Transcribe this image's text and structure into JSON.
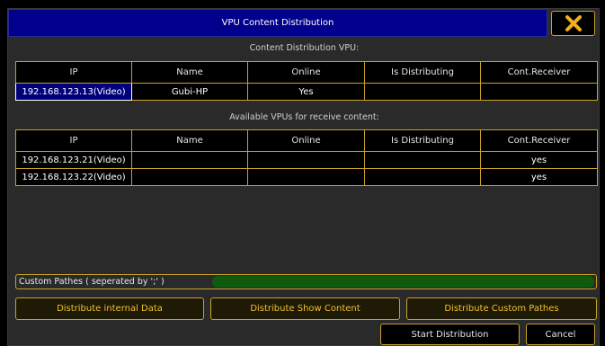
{
  "window": {
    "title": "VPU Content Distribution",
    "close_icon": "close-x-icon"
  },
  "content_distribution": {
    "section_label": "Content Distribution VPU:",
    "columns": [
      "IP",
      "Name",
      "Online",
      "Is Distributing",
      "Cont.Receiver"
    ],
    "rows": [
      {
        "ip": "192.168.123.13(Video)",
        "name": "Gubi-HP",
        "online": "Yes",
        "is_distributing": "",
        "cont_receiver": ""
      }
    ]
  },
  "available": {
    "section_label": "Available VPUs for receive content:",
    "columns": [
      "IP",
      "Name",
      "Online",
      "Is Distributing",
      "Cont.Receiver"
    ],
    "rows": [
      {
        "ip": "192.168.123.21(Video)",
        "name": "",
        "online": "",
        "is_distributing": "",
        "cont_receiver": "yes"
      },
      {
        "ip": "192.168.123.22(Video)",
        "name": "",
        "online": "",
        "is_distributing": "",
        "cont_receiver": "yes"
      }
    ]
  },
  "custom_paths": {
    "label": "Custom Pathes ( seperated by ';' )",
    "value": ""
  },
  "actions": {
    "distribute_internal": "Distribute internal Data",
    "distribute_show": "Distribute Show Content",
    "distribute_custom": "Distribute Custom Pathes"
  },
  "footer": {
    "start_distribution": "Start Distribution",
    "cancel": "Cancel"
  },
  "colors": {
    "title_bar": "#00008c",
    "border_accent": "#c9a227",
    "button_text": "#f0c02a",
    "input_fill": "#0f5a0f"
  }
}
